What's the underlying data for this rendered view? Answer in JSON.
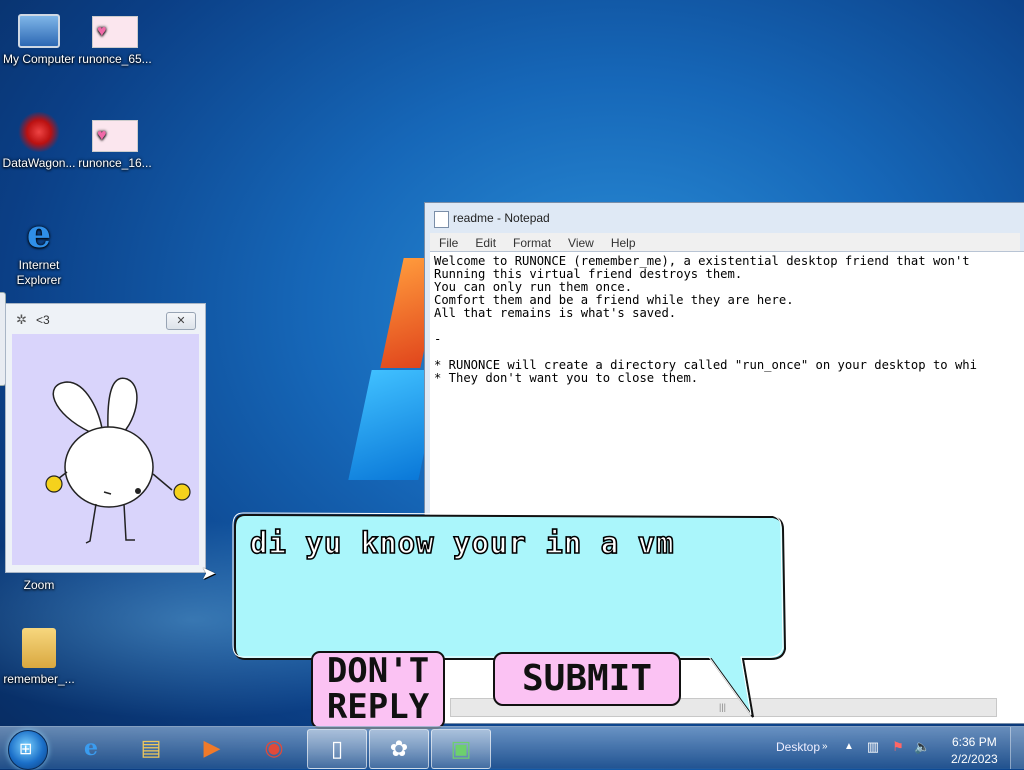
{
  "desktop": {
    "icons": [
      {
        "label": "My Computer",
        "icon": "computer-icon"
      },
      {
        "label": "runonce_65...",
        "icon": "image-thumbnail-icon"
      },
      {
        "label": "DataWagon...",
        "icon": "datawagon-shortcut-icon"
      },
      {
        "label": "runonce_16...",
        "icon": "image-thumbnail-icon"
      },
      {
        "label": "Internet Explorer",
        "icon": "internet-explorer-icon"
      },
      {
        "label": "Zoom",
        "icon": "zoom-icon"
      },
      {
        "label": "remember_...",
        "icon": "folder-icon"
      }
    ]
  },
  "notepad": {
    "title": "readme - Notepad",
    "menu": [
      "File",
      "Edit",
      "Format",
      "View",
      "Help"
    ],
    "content": "Welcome to RUNONCE (remember_me), a existential desktop friend that won't\nRunning this virtual friend destroys them.\nYou can only run them once.\nComfort them and be a friend while they are here.\nAll that remains is what's saved.\n\n-\n\n* RUNONCE will create a directory called \"run_once\" on your desktop to whi\n* They don't want you to close them."
  },
  "bunny_window": {
    "title": "<3",
    "close_label": "✕"
  },
  "dialog": {
    "message": "di yu know your in a vm",
    "dont_reply_line1": "DON'T",
    "dont_reply_line2": "REPLY",
    "submit_label": "SUBMIT"
  },
  "taskbar": {
    "items": [
      "Internet Explorer",
      "File Explorer",
      "Media Player",
      "Google Chrome",
      "Notepad",
      "RUNONCE",
      "Task Manager"
    ],
    "desktop_label": "Desktop",
    "time": "6:36 PM",
    "date": "2/2/2023"
  },
  "colors": {
    "bubble_fill": "#aaf6fb",
    "button_pink": "#fbc2f3",
    "bunny_bg": "#d9d4fb",
    "accent_yellow": "#f5d21c"
  }
}
